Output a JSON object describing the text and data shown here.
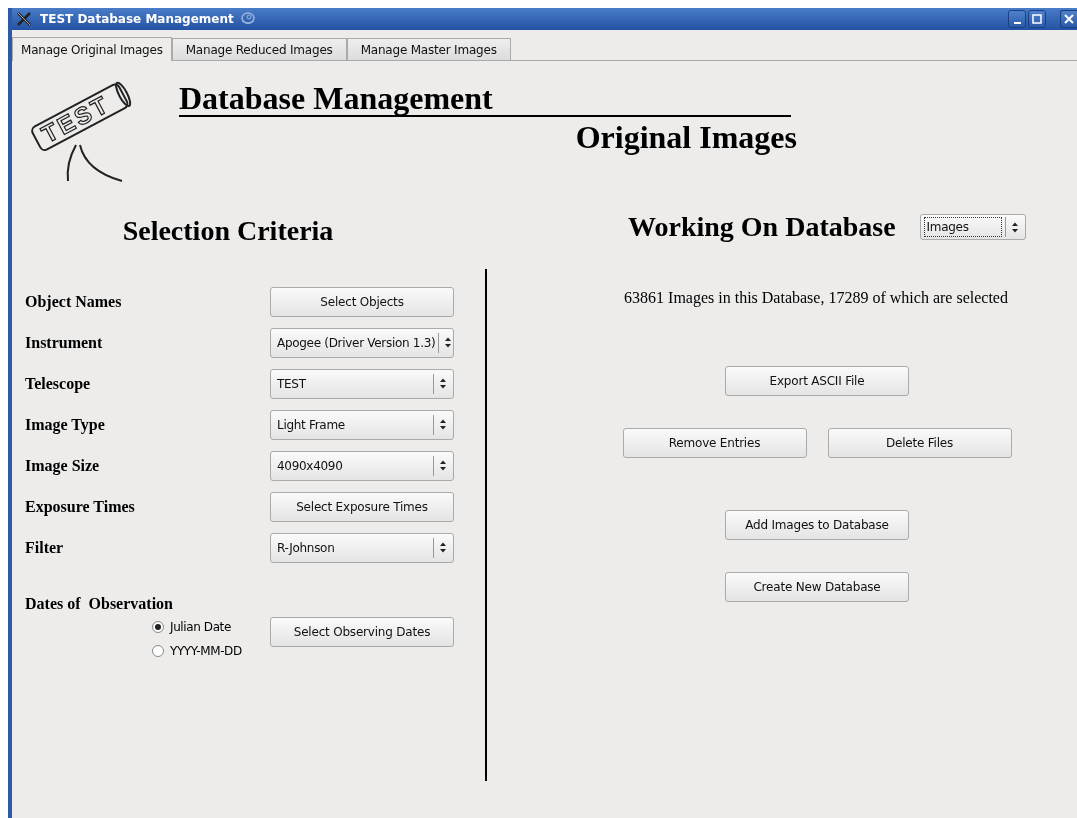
{
  "window": {
    "title": "TEST Database Management"
  },
  "tabs": [
    {
      "label": "Manage Original Images",
      "selected": true
    },
    {
      "label": "Manage Reduced Images",
      "selected": false
    },
    {
      "label": "Manage Master Images",
      "selected": false
    }
  ],
  "header": {
    "logo_text": "TEST",
    "title": "Database Management",
    "subtitle": "Original Images"
  },
  "selection": {
    "heading": "Selection Criteria",
    "rows": [
      {
        "label": "Object Names",
        "kind": "button",
        "text": "Select Objects"
      },
      {
        "label": "Instrument",
        "kind": "dropdown",
        "text": "Apogee (Driver Version 1.3)"
      },
      {
        "label": "Telescope",
        "kind": "dropdown",
        "text": "TEST"
      },
      {
        "label": "Image Type",
        "kind": "dropdown",
        "text": "Light Frame"
      },
      {
        "label": "Image Size",
        "kind": "dropdown",
        "text": "4090x4090"
      },
      {
        "label": "Exposure Times",
        "kind": "button",
        "text": "Select Exposure Times"
      },
      {
        "label": "Filter",
        "kind": "dropdown",
        "text": "R-Johnson"
      }
    ],
    "dates": {
      "label": "Dates of  Observation",
      "options": [
        {
          "label": "Julian Date",
          "selected": true
        },
        {
          "label": "YYYY-MM-DD",
          "selected": false
        }
      ],
      "button": "Select Observing Dates"
    }
  },
  "database": {
    "heading": "Working On Database",
    "dropdown": "Images",
    "summary": "63861 Images in this Database, 17289 of which are selected",
    "button_rows": [
      [
        "Export ASCII File"
      ],
      [
        "Remove Entries",
        "Delete Files"
      ],
      [
        "Add Images to Database"
      ],
      [
        "Create New Database"
      ]
    ]
  }
}
